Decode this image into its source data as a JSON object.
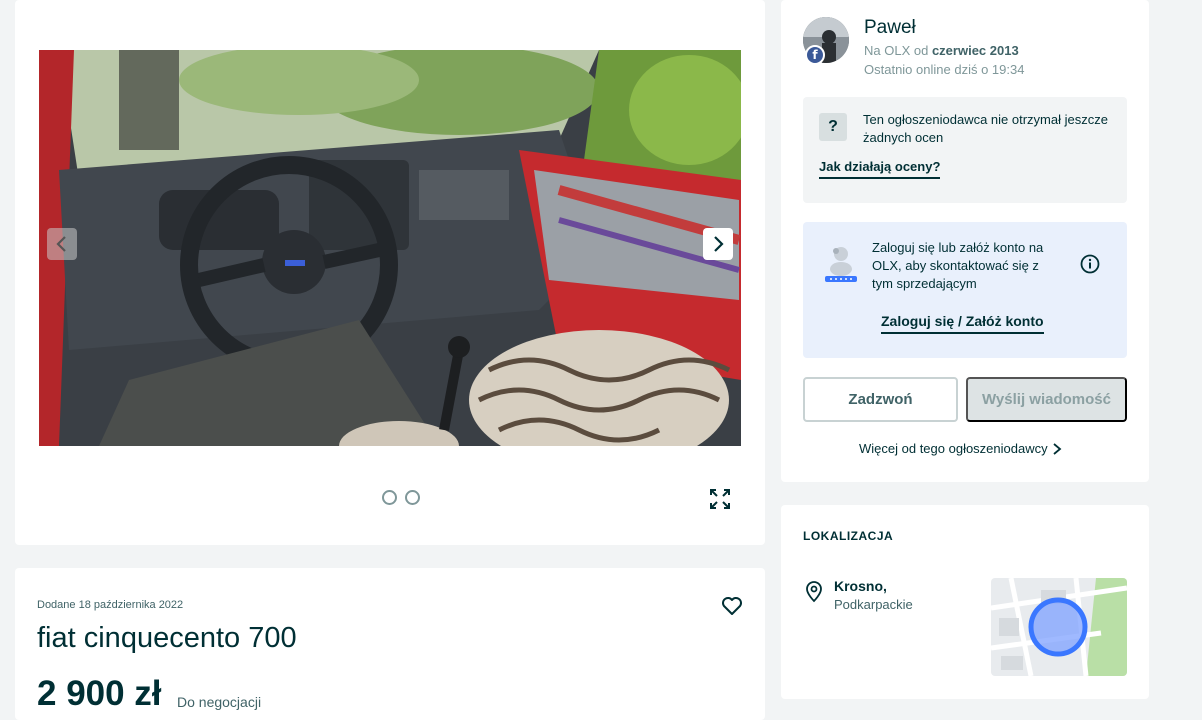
{
  "gallery": {
    "prev_icon": "chevron-left-icon",
    "next_icon": "chevron-right-icon",
    "expand_icon": "expand-icon"
  },
  "listing": {
    "added": "Dodane 18 października 2022",
    "title": "fiat cinquecento 700",
    "price": "2 900 zł",
    "negotiable": "Do negocjacji"
  },
  "seller": {
    "name": "Paweł",
    "since_prefix": "Na OLX od",
    "since_date": "czerwiec 2013",
    "last_online": "Ostatnio online dziś o 19:34",
    "ratings_text": "Ten ogłoszeniodawca nie otrzymał jeszcze żadnych ocen",
    "ratings_link": "Jak działają oceny?",
    "login_text": "Zaloguj się lub załóż konto na OLX, aby skontaktować się z tym sprzedającym",
    "login_link": "Zaloguj się / Załóż konto",
    "call_button": "Zadzwoń",
    "message_button": "Wyślij wiadomość",
    "more_link": "Więcej od tego ogłoszeniodawcy"
  },
  "location": {
    "header": "LOKALIZACJA",
    "city": "Krosno,",
    "region": "Podkarpackie"
  },
  "colors": {
    "brand_dark": "#002f34",
    "background": "#f2f4f5",
    "login_box": "#e9f0fc",
    "map_marker": "#3a77ff"
  }
}
